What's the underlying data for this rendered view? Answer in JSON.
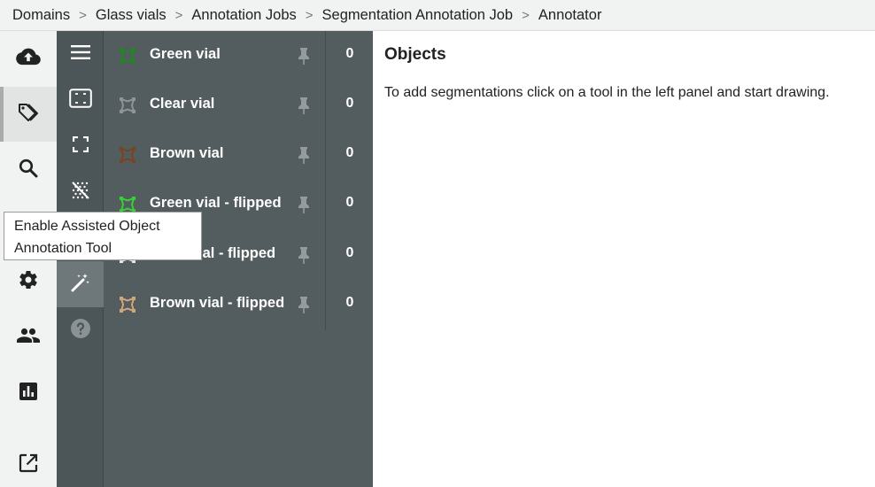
{
  "breadcrumb": [
    "Domains",
    "Glass vials",
    "Annotation Jobs",
    "Segmentation Annotation Job",
    "Annotator"
  ],
  "breadcrumb_separator": ">",
  "nav": [
    {
      "icon": "cloud-upload-icon",
      "active": false
    },
    {
      "icon": "tag-icon",
      "active": true
    },
    {
      "icon": "search-icon",
      "active": false
    },
    {
      "icon": "settings-icon",
      "active": false
    },
    {
      "icon": "people-icon",
      "active": false
    },
    {
      "icon": "bar-chart-icon",
      "active": false
    },
    {
      "icon": "open-external-icon",
      "active": false
    }
  ],
  "tools": [
    {
      "icon": "menu-icon"
    },
    {
      "icon": "bounding-box-icon"
    },
    {
      "icon": "fullscreen-select-icon"
    },
    {
      "icon": "dotted-brush-icon"
    },
    {
      "icon": "magic-wand-icon",
      "active": true
    },
    {
      "icon": "help-icon"
    }
  ],
  "labels": [
    {
      "name": "Green vial",
      "count": "0",
      "color": "#1e8a1e"
    },
    {
      "name": "Clear vial",
      "count": "0",
      "color": "#8f9596"
    },
    {
      "name": "Brown vial",
      "count": "0",
      "color": "#7a4420"
    },
    {
      "name": "Green vial - flipped",
      "count": "0",
      "color": "#35d235"
    },
    {
      "name": "Clear vial - flipped",
      "count": "0",
      "color": "#e6e6e6"
    },
    {
      "name": "Brown vial - flipped",
      "count": "0",
      "color": "#d1a77a"
    }
  ],
  "objects": {
    "title": "Objects",
    "hint": "To add segmentations click on a tool in the left panel and start drawing."
  },
  "tooltip": {
    "line1": "Enable Assisted Object",
    "line2": "Annotation Tool"
  }
}
